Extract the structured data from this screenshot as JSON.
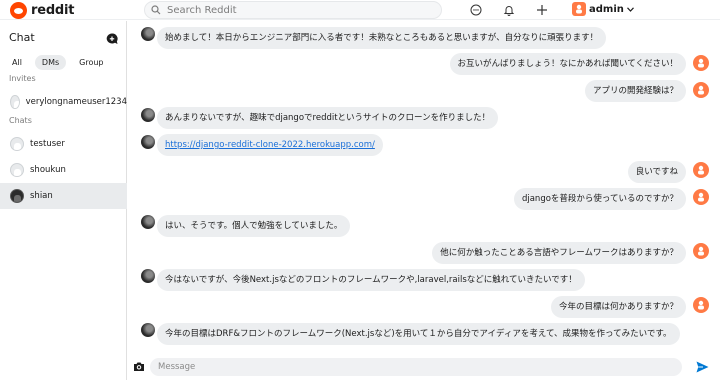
{
  "app": {
    "brand": "reddit",
    "brand_color": "#ff4500"
  },
  "search": {
    "placeholder": "Search Reddit"
  },
  "header": {
    "user_name": "admin"
  },
  "sidebar": {
    "title": "Chat",
    "tabs": [
      {
        "label": "All",
        "active": false
      },
      {
        "label": "DMs",
        "active": true
      },
      {
        "label": "Group",
        "active": false
      }
    ],
    "invites_label": "Invites",
    "invites": [
      {
        "name": "verylongnameuser1234"
      }
    ],
    "chats_label": "Chats",
    "chats": [
      {
        "name": "testuser",
        "active": false
      },
      {
        "name": "shoukun",
        "active": false
      },
      {
        "name": "shian",
        "active": true
      }
    ]
  },
  "messages": [
    {
      "side": "left",
      "text": "始めまして！本日からエンジニア部門に入る者です！未熟なところもあると思いますが、自分なりに頑張ります！"
    },
    {
      "side": "right",
      "text": "お互いがんばりましょう！なにかあれば聞いてください！"
    },
    {
      "side": "right",
      "text": "アプリの開発経験は？"
    },
    {
      "side": "left",
      "text": "あんまりないですが、趣味でdjangoでredditというサイトのクローンを作りました！"
    },
    {
      "side": "left",
      "text": "https://django-reddit-clone-2022.herokuapp.com/",
      "link": true
    },
    {
      "side": "right",
      "text": "良いですね"
    },
    {
      "side": "right",
      "text": "djangoを普段から使っているのですか？"
    },
    {
      "side": "left",
      "text": "はい、そうです。個人で勉強をしていました。"
    },
    {
      "side": "right",
      "text": "他に何か触ったことある言語やフレームワークはありますか？"
    },
    {
      "side": "left",
      "text": "今はないですが、今後Next.jsなどのフロントのフレームワークや,laravel,railsなどに触れていきたいです！"
    },
    {
      "side": "right",
      "text": "今年の目標は何かありますか？"
    },
    {
      "side": "left",
      "text": "今年の目標はDRF&フロントのフレームワーク(Next.jsなど)を用いて１から自分でアイディアを考えて、成果物を作ってみたいです。"
    }
  ],
  "composer": {
    "placeholder": "Message"
  },
  "icons": {
    "logo": "reddit-logo-icon",
    "search": "search-icon",
    "chat": "chat-icon",
    "notifications": "bell-icon",
    "create": "plus-icon",
    "camera": "camera-icon",
    "send": "send-icon"
  }
}
